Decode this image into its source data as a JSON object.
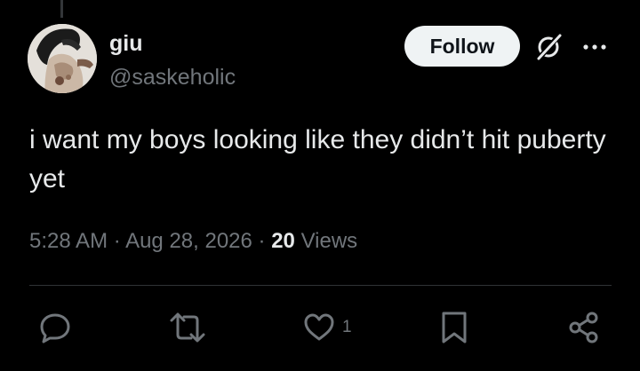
{
  "author": {
    "name": "giu",
    "handle": "@saskeholic"
  },
  "actions_top": {
    "follow_label": "Follow",
    "grok_icon": "grok-icon",
    "more_icon": "more-icon"
  },
  "tweet": {
    "text": "i want my boys looking like they didn’t hit puberty yet"
  },
  "meta": {
    "time": "5:28 AM",
    "separator1": " · ",
    "date": "Aug 28, 2026",
    "separator2": " · ",
    "views_count": "20",
    "views_label": " Views"
  },
  "action_bar": {
    "reply_icon": "reply-icon",
    "retweet_icon": "retweet-icon",
    "like_icon": "heart-icon",
    "like_count": "1",
    "bookmark_icon": "bookmark-icon",
    "share_icon": "share-icon"
  },
  "colors": {
    "background": "#000000",
    "primary_text": "#e7e9ea",
    "secondary_text": "#71767b",
    "follow_bg": "#eff3f4",
    "divider": "#2f3336"
  }
}
